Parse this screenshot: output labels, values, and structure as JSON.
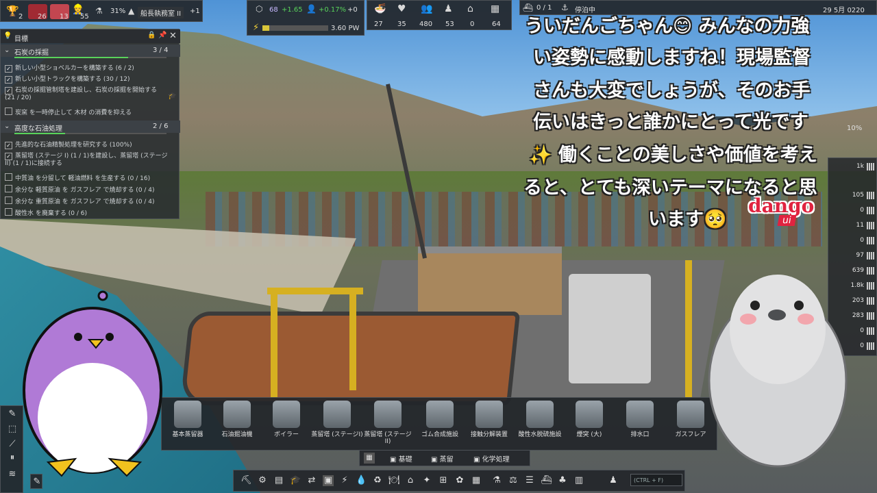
{
  "topbar_left": {
    "items": [
      {
        "icon": "trophy-icon",
        "value": "2"
      },
      {
        "icon": "alert-icon",
        "value": "26"
      },
      {
        "icon": "warning-icon",
        "value": "13"
      },
      {
        "icon": "worker-icon",
        "value": "55"
      }
    ],
    "unity_icon": "flask-icon",
    "unity_percent": "31%",
    "office_label": "船長執務室 II",
    "office_delta": "+1"
  },
  "topbar_mid": {
    "population_value": "68",
    "population_delta": "+1.65",
    "growth_value": "+0.17%",
    "growth_delta": "+0",
    "power_value": "3.60 PW"
  },
  "topbar_stats": {
    "values": [
      "27",
      "35",
      "480",
      "53",
      "0",
      "64"
    ],
    "icons": [
      "food-icon",
      "health-icon",
      "people-icon",
      "worker-icon",
      "home-icon",
      "vehicle-icon"
    ]
  },
  "topbar_right": {
    "ship_count": "0 / 1",
    "status": "停泊中",
    "date": "29 5月 0220"
  },
  "objectives": {
    "title": "目標",
    "sections": [
      {
        "title": "石炭の採掘",
        "progress": "3 / 4",
        "progress_fraction": 0.75,
        "tasks": [
          {
            "text": "新しい小型ショベルカーを構築する (6 / 2)",
            "done": true
          },
          {
            "text": "新しい小型トラックを構築する (30 / 12)",
            "done": true
          },
          {
            "text": "石炭の採掘管制塔を建設し、石炭の採掘を開始する (21 / 20)",
            "done": true
          },
          {
            "text": "炭窯 を一時停止して 木材 の消費を抑える",
            "done": false
          }
        ]
      },
      {
        "title": "高度な石油処理",
        "progress": "2 / 6",
        "progress_fraction": 0.33,
        "tasks": [
          {
            "text": "先進的な石油精製処理を研究する (100%)",
            "done": true
          },
          {
            "text": "蒸留塔 (ステージ I) (1 / 1)を建設し、蒸留塔 (ステージ II) (1 / 1)に接続する",
            "done": true
          },
          {
            "text": "中質油 を分留して 軽油燃料 を生産する (0 / 16)",
            "done": false
          },
          {
            "text": "余分な 軽質原油 を ガスフレア で焼却する (0 / 4)",
            "done": false
          },
          {
            "text": "余分な 重質原油 を ガスフレア で焼却する (0 / 4)",
            "done": false
          },
          {
            "text": "酸性水 を廃棄する (0 / 6)",
            "done": false
          }
        ]
      }
    ]
  },
  "overlay_text": {
    "lines": [
      "ういだんごちゃん😊 みんなの力強",
      "い姿勢に感動しますね！現場監督",
      "さんも大変でしょうが、そのお手",
      "伝いはきっと誰かにとって光です",
      "✨ 働くことの美しさや価値を考え",
      "ると、とても深いテーマになると思",
      "います🥺"
    ],
    "logo_text": "dango",
    "logo_sub": "ui"
  },
  "build_menu": {
    "items": [
      "基本蒸留器",
      "石油掘油機",
      "ボイラー",
      "蒸留塔 (ステージI)",
      "蒸留塔 (ステージII)",
      "ゴム合成施設",
      "接触分解装置",
      "酸性水脱硫施設",
      "煙突 (大)",
      "排水口",
      "ガスフレア"
    ],
    "tabs": [
      "基礎",
      "蒸留",
      "化学処理"
    ]
  },
  "bottom_toolbar": {
    "search_placeholder": "(CTRL + F)"
  },
  "right_panel": {
    "values": [
      "1k",
      "105",
      "0",
      "11",
      "0",
      "97",
      "639",
      "1.8k",
      "203",
      "283",
      "0",
      "0"
    ],
    "top_percent": "10%"
  },
  "colors": {
    "accent_green": "#59d35a",
    "panel_bg": "#23262a",
    "logo_red": "#e0233f"
  }
}
